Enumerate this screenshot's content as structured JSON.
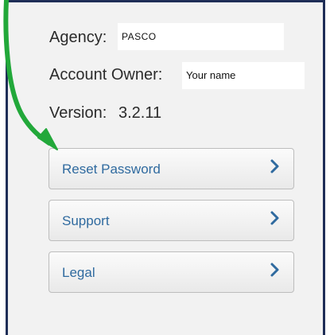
{
  "account": {
    "agency_label": "Agency:",
    "agency_value": "PASCO",
    "owner_label": "Account Owner:",
    "owner_value": "Your name",
    "version_label": "Version:",
    "version_value": "3.2.11"
  },
  "menu": [
    {
      "label": "Reset Password",
      "icon": "chevron-right-icon"
    },
    {
      "label": "Support",
      "icon": "chevron-right-icon"
    },
    {
      "label": "Legal",
      "icon": "chevron-right-icon"
    }
  ],
  "colors": {
    "frame_border": "#1f2e57",
    "link_text": "#2f6a9f",
    "annotation_arrow": "#22a83a"
  }
}
